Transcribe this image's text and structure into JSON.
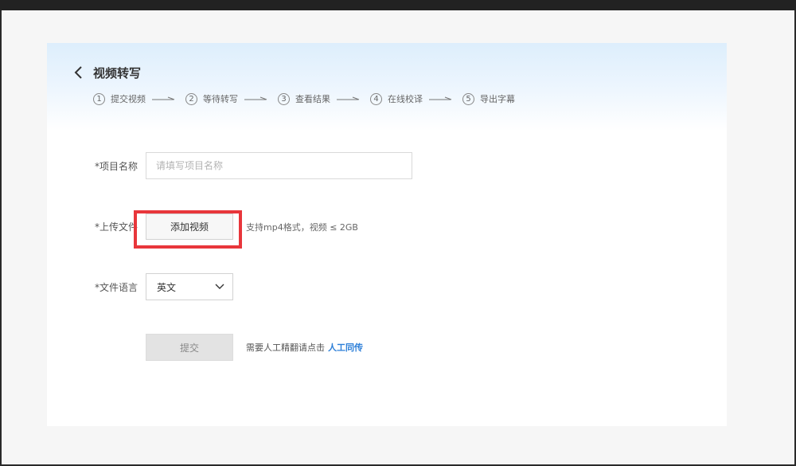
{
  "page": {
    "title": "视频转写"
  },
  "steps": [
    {
      "num": "1",
      "label": "提交视频"
    },
    {
      "num": "2",
      "label": "等待转写"
    },
    {
      "num": "3",
      "label": "查看结果"
    },
    {
      "num": "4",
      "label": "在线校译"
    },
    {
      "num": "5",
      "label": "导出字幕"
    }
  ],
  "form": {
    "name": {
      "label": "*项目名称",
      "placeholder": "请填写项目名称",
      "value": ""
    },
    "upload": {
      "label": "*上传文件",
      "button": "添加视频",
      "hint": "支持mp4格式，视频 ≤ 2GB"
    },
    "language": {
      "label": "*文件语言",
      "selected": "英文"
    },
    "submit": {
      "label": "提交",
      "hint": "需要人工精翻请点击",
      "link": "人工同传"
    }
  },
  "colors": {
    "accent": "#2d7fd8",
    "highlight": "#e8363b",
    "header_gradient": "#ddeefc"
  },
  "icons": {
    "back": "chevron-left-icon",
    "step_arrow": "arrow-right-icon",
    "dropdown": "chevron-down-icon"
  }
}
